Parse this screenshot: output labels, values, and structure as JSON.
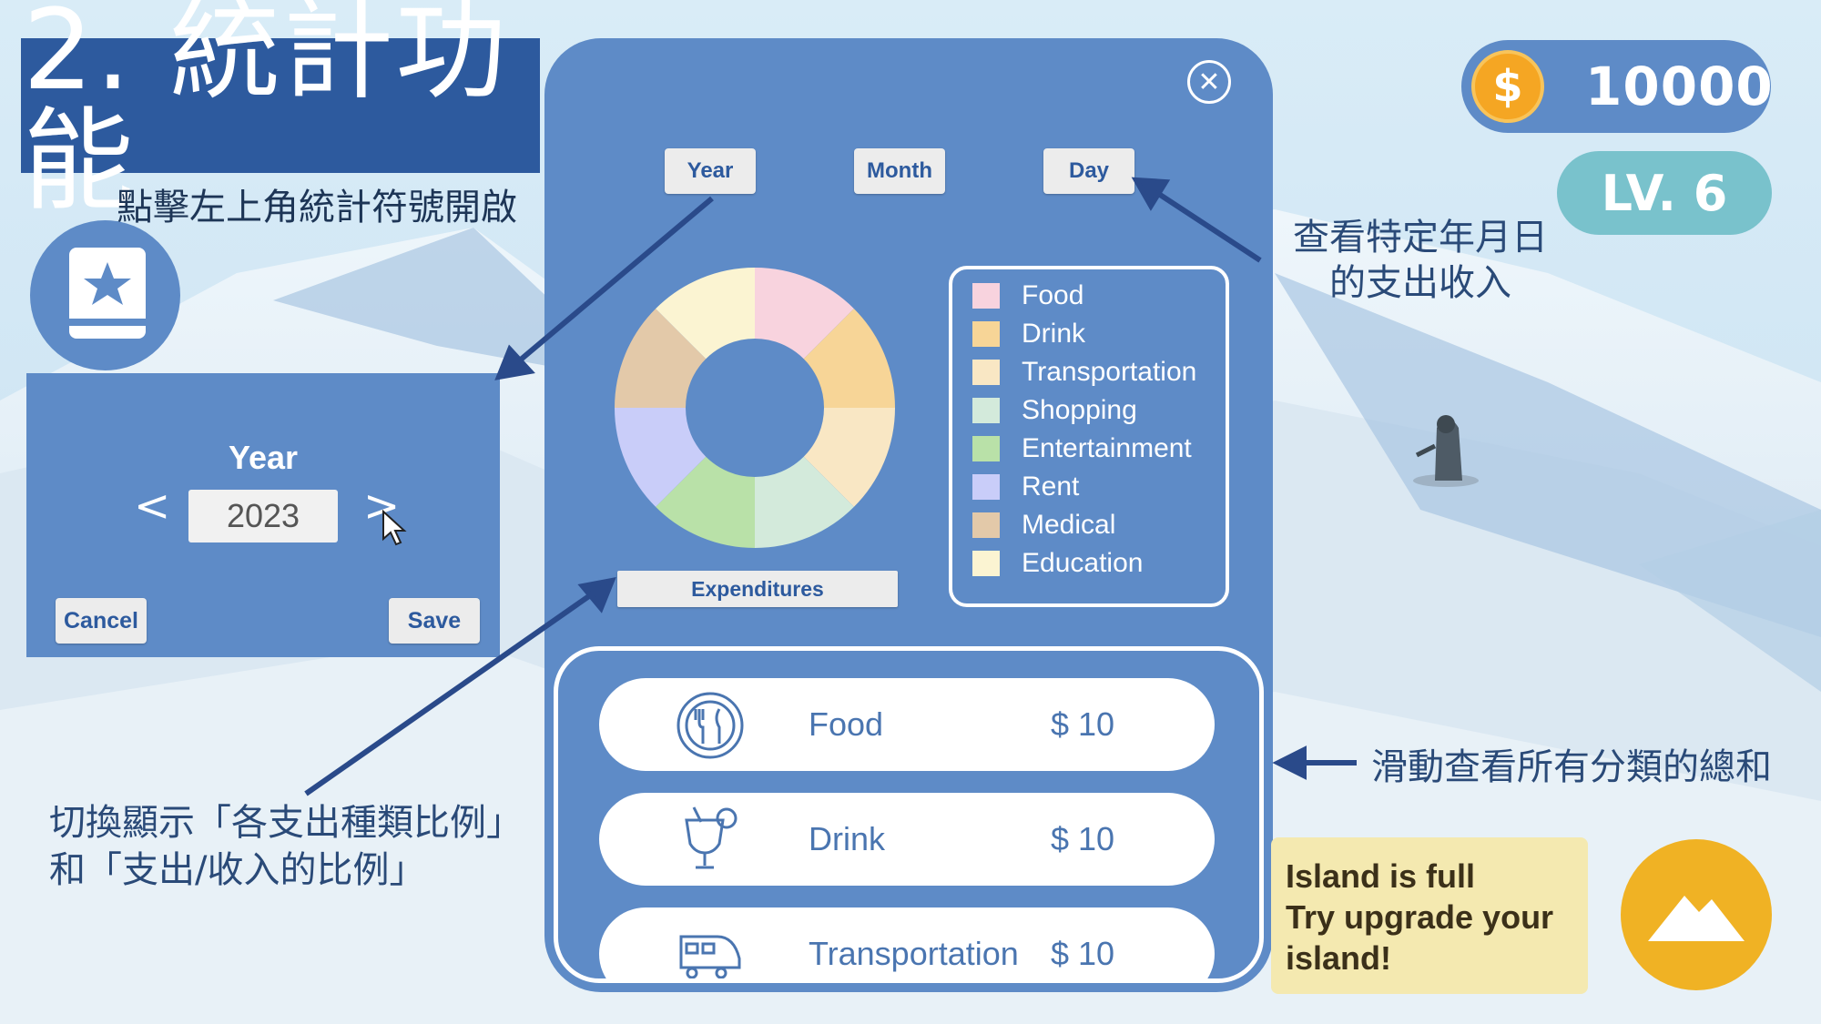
{
  "slide": {
    "title": "2. 統計功能",
    "subtitle": "點擊左上角統計符號開啟",
    "note_view": [
      "查看特定年月日",
      "的支出收入"
    ],
    "note_scroll": "滑動查看所有分類的總和",
    "note_toggle": [
      "切換顯示「各支出種類比例」",
      "和「支出/收入的比例」"
    ]
  },
  "hud": {
    "coin_symbol": "$",
    "coins": "10000",
    "level": "LV. 6"
  },
  "year_dialog": {
    "label": "Year",
    "value": "2023",
    "prev": "<",
    "next": ">",
    "cancel": "Cancel",
    "save": "Save"
  },
  "stats": {
    "close": "✕",
    "tabs": {
      "year": "Year",
      "month": "Month",
      "day": "Day"
    },
    "chart_toggle": "Expenditures",
    "legend": [
      {
        "label": "Food",
        "color": "#f8d3de"
      },
      {
        "label": "Drink",
        "color": "#f7d597"
      },
      {
        "label": "Transportation",
        "color": "#f9e7c4"
      },
      {
        "label": "Shopping",
        "color": "#d3eadb"
      },
      {
        "label": "Entertainment",
        "color": "#b9e1a8"
      },
      {
        "label": "Rent",
        "color": "#c9cdf9"
      },
      {
        "label": "Medical",
        "color": "#e3c9a9"
      },
      {
        "label": "Education",
        "color": "#fbf4d2"
      }
    ],
    "rows": [
      {
        "name": "Food",
        "amount": "$ 10",
        "icon": "fork-knife-plate-icon"
      },
      {
        "name": "Drink",
        "amount": "$ 10",
        "icon": "cocktail-icon"
      },
      {
        "name": "Transportation",
        "amount": "$ 10",
        "icon": "train-icon"
      }
    ]
  },
  "toast": {
    "lines": [
      "Island is full",
      "Try upgrade your",
      "island!"
    ]
  },
  "chart_data": {
    "type": "pie",
    "style": "donut",
    "categories": [
      "Food",
      "Drink",
      "Transportation",
      "Shopping",
      "Entertainment",
      "Rent",
      "Medical",
      "Education"
    ],
    "values": [
      1,
      1,
      1,
      1,
      1,
      1,
      1,
      1
    ],
    "colors": [
      "#f8d3de",
      "#f7d597",
      "#f9e7c4",
      "#d3eadb",
      "#b9e1a8",
      "#c9cdf9",
      "#e3c9a9",
      "#fbf4d2"
    ],
    "legend": "right"
  },
  "colors": {
    "panel": "#5e8bc7",
    "title_bg": "#2d5a9e",
    "coin": "#f5a623",
    "level": "#79c2cc",
    "toast": "#f4e9b0",
    "mountain_button": "#f0b224"
  }
}
